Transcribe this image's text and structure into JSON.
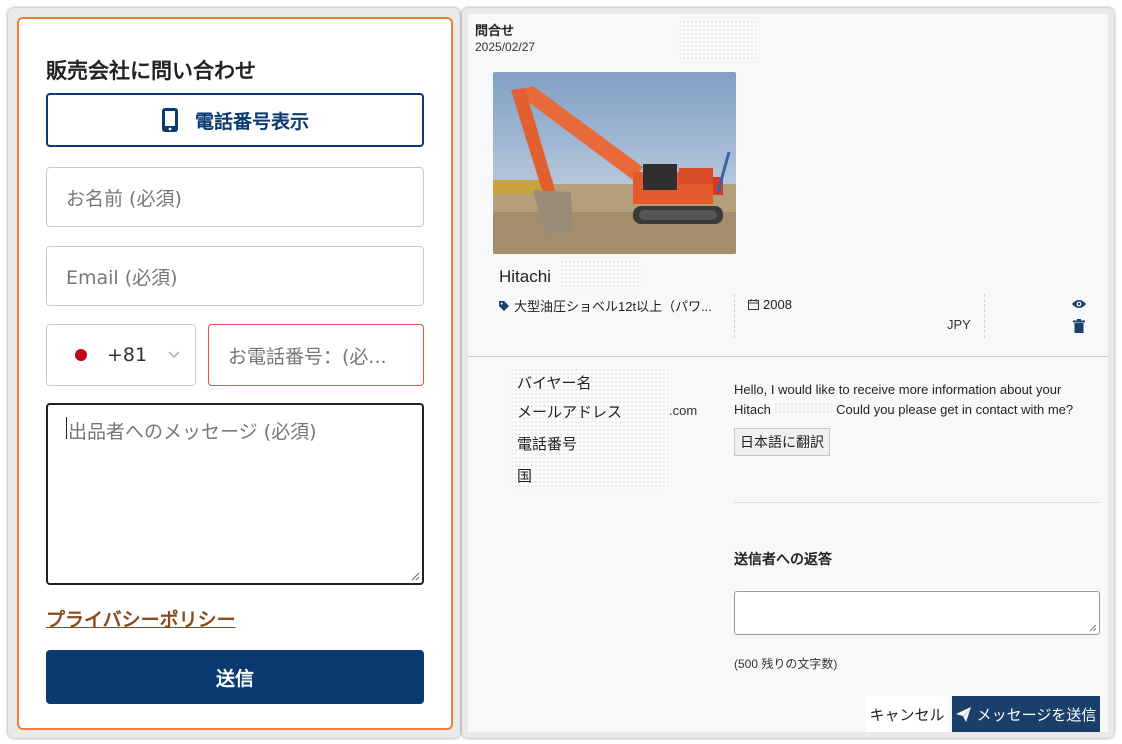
{
  "contact_form": {
    "title": "販売会社に問い合わせ",
    "phone_button_label": "電話番号表示",
    "name_placeholder": "お名前 (必須)",
    "email_placeholder": "Email (必須)",
    "country_code": "+81",
    "phone_placeholder": "お電話番号：(必...",
    "message_placeholder": "出品者へのメッセージ (必須)",
    "privacy_link": "プライバシーポリシー",
    "submit_label": "送信",
    "colors": {
      "accent_border": "#f07b3f",
      "primary": "#0b3a73",
      "error_border": "#e05050",
      "link": "#8a4a1c"
    }
  },
  "inquiry": {
    "label": "問合せ",
    "date": "2025/02/27",
    "machine_name": "Hitachi",
    "category": "大型油圧ショベル12t以上（パワ...",
    "year": "2008",
    "currency": "JPY",
    "buyer_fields": {
      "name_label": "バイヤー名",
      "email_label": "メールアドレス",
      "email_suffix": ".com",
      "phone_label": "電話番号",
      "country_label": "国"
    },
    "message_line1": "Hello, I would like to receive more information about your",
    "message_line2_start": "Hitach",
    "message_line2_end": "Could you please get in contact with me?",
    "translate_button": "日本語に翻訳",
    "reply_label": "送信者への返答",
    "char_count": "(500 残りの文字数)",
    "cancel_label": "キャンセル",
    "send_label": "メッセージを送信",
    "colors": {
      "send_button": "#1b3f6b"
    }
  }
}
